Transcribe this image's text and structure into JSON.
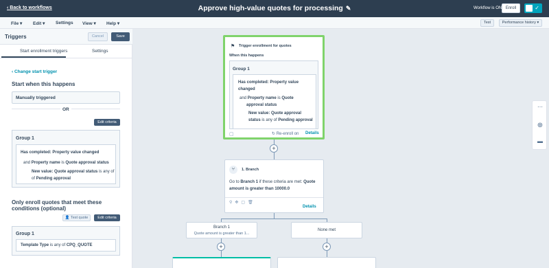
{
  "topbar": {
    "back_label": "Back to workflows",
    "title": "Approve high-value quotes for processing",
    "workflow_status": "Workflow is ON",
    "enroll_label": "Enroll",
    "toggle_check": "✓"
  },
  "menu": {
    "items": [
      "File",
      "Edit",
      "Settings",
      "View",
      "Help"
    ],
    "test_label": "Test",
    "performance_label": "Performance history"
  },
  "panel": {
    "title": "Triggers",
    "cancel_label": "Cancel",
    "save_label": "Save",
    "tabs": [
      "Start enrollment triggers",
      "Settings"
    ],
    "change_trigger": "Change start trigger",
    "start_heading": "Start when this happens",
    "trigger_value": "Manually triggered",
    "or_label": "OR",
    "edit_criteria": "Edit criteria",
    "group1": {
      "title": "Group 1",
      "line1_label": "Has completed:",
      "line1_value": "Property value changed",
      "line2_prefix": "and",
      "line2_label": "Property name",
      "line2_mid": "is",
      "line2_value": "Quote approval status",
      "line3_label": "New value:",
      "line3_value": "Quote approval status",
      "line3_mid": "is any of",
      "line3_value2": "Pending approval"
    },
    "conditions_heading": "Only enroll quotes that meet these conditions (optional)",
    "test_quote": "Test quote",
    "edit_criteria2": "Edit criteria",
    "group2": {
      "title": "Group 1",
      "label": "Template Type",
      "mid": "is any of",
      "value": "CPQ_QUOTE"
    }
  },
  "canvas": {
    "trigger_card": {
      "title": "Trigger enrollment for quotes",
      "subtitle": "When this happens",
      "group_title": "Group 1",
      "c1_label": "Has completed:",
      "c1_value": "Property value changed",
      "c2_prefix": "and",
      "c2_label": "Property name",
      "c2_mid": "is",
      "c2_value": "Quote approval status",
      "c3_label": "New value:",
      "c3_value": "Quote approval",
      "c3_value_b": "status",
      "c3_mid": "is any of",
      "c3_value2": "Pending",
      "c3_value2_b": "approval",
      "reenroll": "Re-enroll on",
      "details": "Details"
    },
    "branch_card": {
      "title": "1. Branch",
      "text_go": "Go to",
      "text_branch": "Branch 1",
      "text_mid": "if these criteria are met:",
      "text_crit": "Quote amount is greater than 10000.0",
      "details": "Details"
    },
    "branch1": {
      "title": "Branch 1",
      "subtitle": "Quote amount is greater than 1..."
    },
    "none_met": {
      "title": "None met"
    }
  }
}
